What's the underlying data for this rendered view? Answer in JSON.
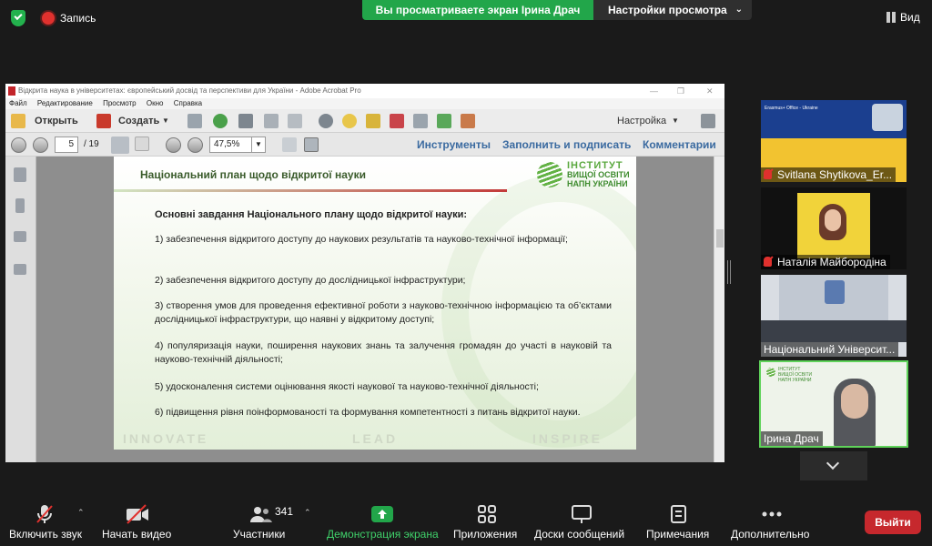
{
  "topbar": {
    "record_label": "Запись",
    "share_banner": "Вы просматриваете экран Ірина Драч",
    "view_settings": "Настройки просмотра",
    "view_button": "Вид"
  },
  "acrobat": {
    "title": "Відкрита наука в університетах: європейський досвід та перспективи для України - Adobe Acrobat Pro",
    "menu": [
      "Файл",
      "Редактирование",
      "Просмотр",
      "Окно",
      "Справка"
    ],
    "toolbar": {
      "open_label": "Открыть",
      "create_label": "Создать",
      "customize_label": "Настройка"
    },
    "nav": {
      "page_current": "5",
      "page_total": "/ 19",
      "zoom": "47,5%",
      "tools": "Инструменты",
      "fill_sign": "Заполнить и подписать",
      "comments": "Комментарии"
    },
    "slide": {
      "title": "Національний план щодо відкритої науки",
      "logo_line1": "ІНСТИТУТ",
      "logo_line2": "ВИЩОЇ ОСВІТИ",
      "logo_line3": "НАПН УКРАЇНИ",
      "heading": "Основні завдання Національного плану щодо відкритої науки:",
      "items": [
        "1) забезпечення відкритого доступу до наукових результатів та науково-технічної інформації;",
        "2) забезпечення відкритого доступу до дослідницької інфраструктури;",
        "3) створення умов для проведення ефективної роботи з науково-технічною інформацією та об’єктами дослідницької інфраструктури, що наявні у відкритому доступі;",
        "4) популяризація науки, поширення наукових знань та залучення громадян до участі в науковій та науково-технічній діяльності;",
        "5) удосконалення системи оцінювання якості наукової та науково-технічної діяльності;",
        "6) підвищення рівня поінформованості та формування компетентності з питань відкритої науки."
      ],
      "footer": [
        "INNOVATE",
        "LEAD",
        "INSPIRE"
      ]
    }
  },
  "participants": [
    {
      "name": "Svitlana Shytikova_Er...",
      "muted": true
    },
    {
      "name": "Наталія Майбородіна",
      "muted": true
    },
    {
      "name": "Національний Університ...",
      "muted": false
    },
    {
      "name": "Ірина Драч",
      "muted": false
    }
  ],
  "tile_overlay": {
    "tile1_header": "Erasmus+ Office - Ukraine"
  },
  "bottombar": {
    "mute": "Включить звук",
    "video": "Начать видео",
    "participants": "Участники",
    "participants_count": "341",
    "share": "Демонстрация экрана",
    "apps": "Приложения",
    "whiteboards": "Доски сообщений",
    "notes": "Примечания",
    "more": "Дополнительно",
    "leave": "Выйти"
  },
  "colors": {
    "share_green": "#22a64a",
    "leave_red": "#c6282d",
    "active_speaker": "#5fd35a"
  }
}
